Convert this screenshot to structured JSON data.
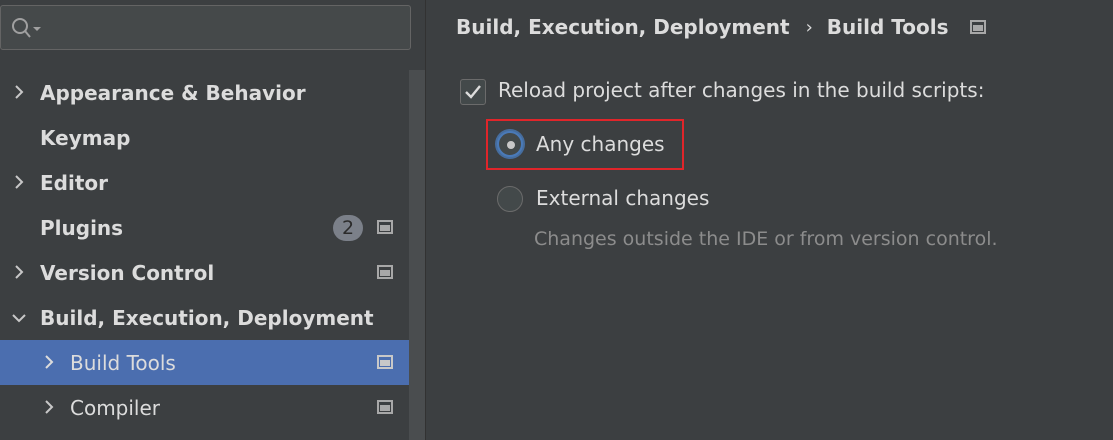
{
  "search": {
    "placeholder": "",
    "value": ""
  },
  "sidebar": {
    "items": [
      {
        "label": "Appearance & Behavior",
        "expandable": true
      },
      {
        "label": "Keymap",
        "expandable": false
      },
      {
        "label": "Editor",
        "expandable": true
      },
      {
        "label": "Plugins",
        "expandable": false,
        "badge": "2"
      },
      {
        "label": "Version Control",
        "expandable": true
      },
      {
        "label": "Build, Execution, Deployment",
        "expandable": true,
        "expanded": true
      },
      {
        "label": "Build Tools",
        "expandable": true,
        "selected": true
      },
      {
        "label": "Compiler",
        "expandable": true
      }
    ]
  },
  "breadcrumb": {
    "parent": "Build, Execution, Deployment",
    "separator": "›",
    "current": "Build Tools"
  },
  "main": {
    "reload_checkbox": {
      "label": "Reload project after changes in the build scripts:",
      "checked": true
    },
    "options": [
      {
        "label": "Any changes",
        "selected": true
      },
      {
        "label": "External changes",
        "selected": false
      }
    ],
    "external_hint": "Changes outside the IDE or from version control."
  },
  "colors": {
    "background": "#3c3f41",
    "selection": "#4b6eaf",
    "highlight": "#e0252a",
    "text": "#dcdcdc",
    "hint": "#8c8c8c"
  }
}
